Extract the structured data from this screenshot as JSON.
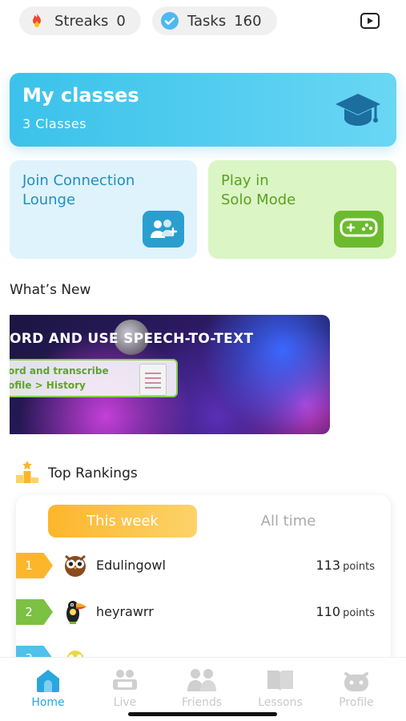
{
  "top_bar": {
    "streaks_label": "Streaks",
    "streaks_count": "0",
    "tasks_label": "Tasks",
    "tasks_count": "160",
    "icons": {
      "streak": "fire-icon",
      "tasks": "check-circle-icon",
      "video": "play-video-icon"
    }
  },
  "classes": {
    "title": "My classes",
    "subtitle": "3  Classes",
    "icon": "graduation-cap-icon"
  },
  "tiles": {
    "join_line1": "Join Connection",
    "join_line2": "Lounge",
    "join_icon": "add-group-icon",
    "solo_line1": "Play in",
    "solo_line2": "Solo Mode",
    "solo_icon": "gamepad-icon"
  },
  "whats_new": {
    "heading": "What’s New",
    "banner_headline": "ORD AND USE SPEECH-TO-TEXT",
    "banner_line1": "ord and transcribe",
    "banner_line2": "ofile > History"
  },
  "rankings": {
    "heading": "Top Rankings",
    "tab_this_week": "This week",
    "tab_all_time": "All time",
    "rows": [
      {
        "rank": "1",
        "name": "Edulingowl",
        "points": "113",
        "unit": "points",
        "color": "#fcb62c"
      },
      {
        "rank": "2",
        "name": "heyrawrr",
        "points": "110",
        "unit": "points",
        "color": "#7cc142"
      },
      {
        "rank": "3",
        "name": "",
        "points": "",
        "unit": "",
        "color": "#4fc1ea"
      }
    ]
  },
  "nav": {
    "items": [
      {
        "label": "Home",
        "icon": "home-icon"
      },
      {
        "label": "Live",
        "icon": "live-icon"
      },
      {
        "label": "Friends",
        "icon": "friends-icon"
      },
      {
        "label": "Lessons",
        "icon": "lessons-book-icon"
      },
      {
        "label": "Profile",
        "icon": "profile-icon"
      }
    ],
    "active": "Home"
  },
  "colors": {
    "accent_blue": "#2aa6df",
    "classes_gradient_start": "#3bc2ea",
    "join_bg": "#dff3fd",
    "solo_bg": "#dbf5c5",
    "rank_gold": "#fcb62c"
  }
}
